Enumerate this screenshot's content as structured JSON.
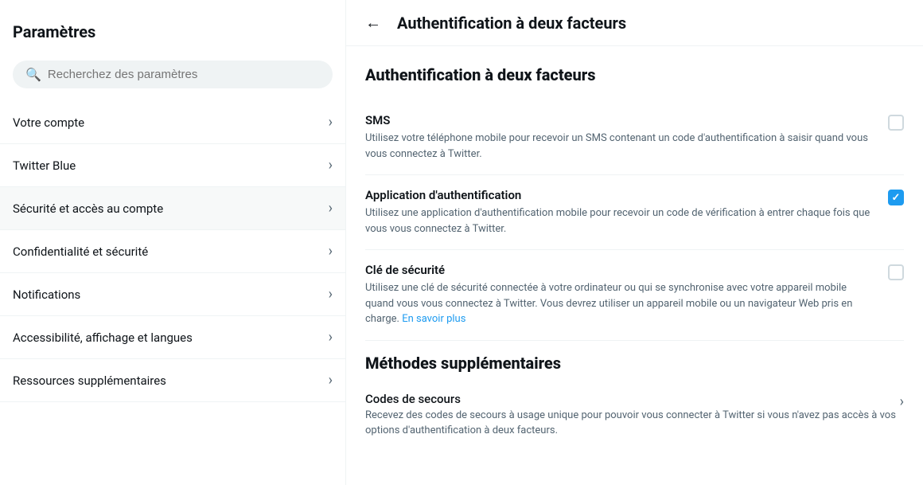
{
  "sidebar": {
    "title": "Paramètres",
    "search": {
      "placeholder": "Recherchez des paramètres",
      "icon": "🔍"
    },
    "items": [
      {
        "id": "votre-compte",
        "label": "Votre compte",
        "active": false
      },
      {
        "id": "twitter-blue",
        "label": "Twitter Blue",
        "active": false
      },
      {
        "id": "securite-acces",
        "label": "Sécurité et accès au compte",
        "active": true
      },
      {
        "id": "confidentialite",
        "label": "Confidentialité et sécurité",
        "active": false
      },
      {
        "id": "notifications",
        "label": "Notifications",
        "active": false
      },
      {
        "id": "accessibilite",
        "label": "Accessibilité, affichage et langues",
        "active": false
      },
      {
        "id": "ressources",
        "label": "Ressources supplémentaires",
        "active": false
      }
    ]
  },
  "main": {
    "header": {
      "back_label": "←",
      "title": "Authentification à deux facteurs"
    },
    "section_title": "Authentification à deux facteurs",
    "options": [
      {
        "id": "sms",
        "title": "SMS",
        "description": "Utilisez votre téléphone mobile pour recevoir un SMS contenant un code d'authentification à saisir quand vous vous connectez à Twitter.",
        "checked": false
      },
      {
        "id": "app-auth",
        "title": "Application d'authentification",
        "description": "Utilisez une application d'authentification mobile pour recevoir un code de vérification à entrer chaque fois que vous vous connectez à Twitter.",
        "checked": true
      },
      {
        "id": "cle-securite",
        "title": "Clé de sécurité",
        "description": "Utilisez une clé de sécurité connectée à votre ordinateur ou qui se synchronise avec votre appareil mobile quand vous vous connectez à Twitter. Vous devrez utiliser un appareil mobile ou un navigateur Web pris en charge.",
        "link_text": "En savoir plus",
        "link_href": "#",
        "checked": false
      }
    ],
    "methods": {
      "title": "Méthodes supplémentaires",
      "items": [
        {
          "id": "codes-secours",
          "title": "Codes de secours",
          "description": "Recevez des codes de secours à usage unique pour pouvoir vous connecter à Twitter si vous n'avez pas accès à vos options d'authentification à deux facteurs."
        }
      ]
    }
  },
  "colors": {
    "checked_blue": "#1d9bf0",
    "link_blue": "#1d9bf0",
    "text_secondary": "#536471",
    "border": "#eff3f4"
  }
}
